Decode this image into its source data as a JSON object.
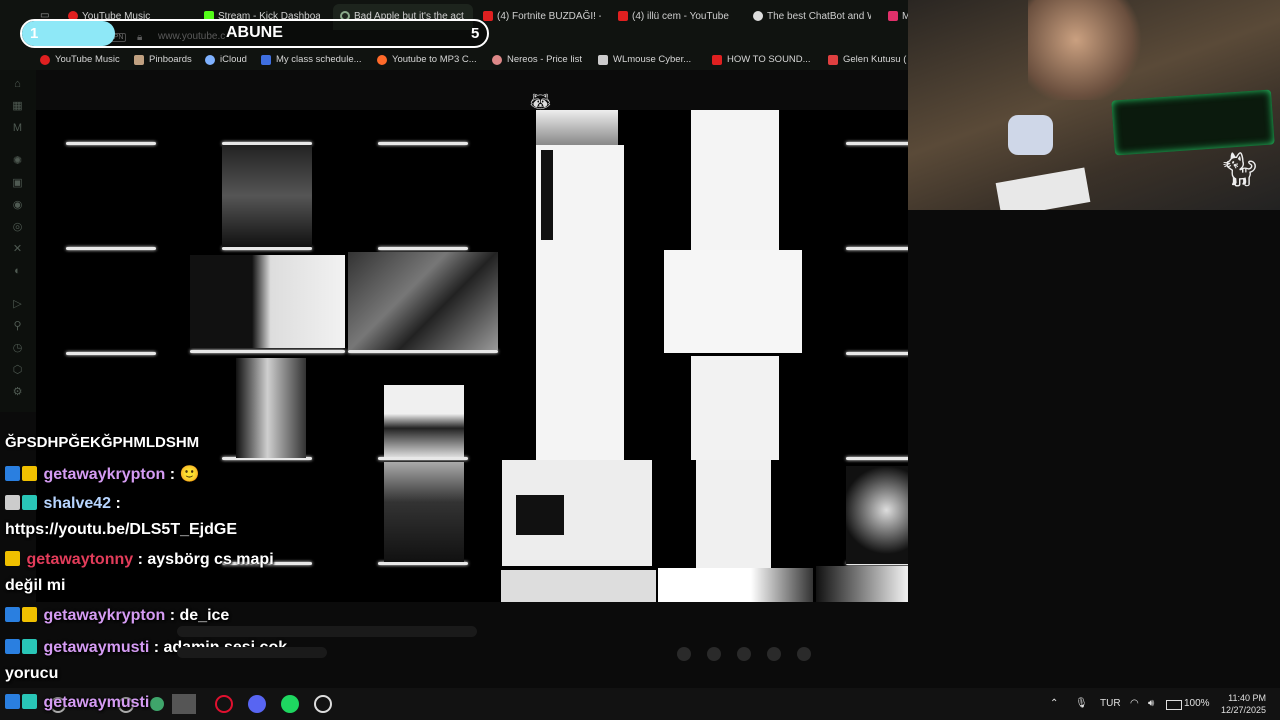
{
  "browser": {
    "tabs": [
      {
        "label": "YouTube Music",
        "color": "#e02020"
      },
      {
        "label": "Stream - Kick Dashboard",
        "color": "#53fc18"
      },
      {
        "label": "Bad Apple but it's the act",
        "color": "#8aa88a"
      },
      {
        "label": "(4) Fortnite BUZDAĞI! -",
        "color": "#e02020"
      },
      {
        "label": "(4) illü cem - YouTube",
        "color": "#e02020"
      },
      {
        "label": "The best ChatBot and W",
        "color": "#dddddd"
      },
      {
        "label": "M",
        "color": "#e0306a"
      }
    ],
    "url": "www.youtube.c",
    "vpn_label": "VPN",
    "bookmarks": [
      {
        "label": "YouTube Music",
        "color": "#e02020"
      },
      {
        "label": "Pinboards",
        "color": "#c0a080"
      },
      {
        "label": "iCloud",
        "color": "#7fb2ff"
      },
      {
        "label": "My class schedule...",
        "color": "#3f6fe0"
      },
      {
        "label": "Youtube to MP3 C...",
        "color": "#ff6a2a"
      },
      {
        "label": "Nereos - Price list",
        "color": "#d88"
      },
      {
        "label": "WLmouse Cyber...",
        "color": "#cccccc"
      },
      {
        "label": "HOW TO SOUND...",
        "color": "#e02020"
      },
      {
        "label": "Gelen Kutusu (",
        "color": "#e04040"
      }
    ]
  },
  "subscribe_goal": {
    "label": "ABUNE",
    "current": "1",
    "goal": "5",
    "progress": 0.2,
    "fill_color": "#8ee8f7"
  },
  "chat": {
    "header": "ĞPSDHPĞEKĞPHMLDSHM",
    "messages": [
      {
        "user": "getawaykrypton",
        "user_color": "#d49bf2",
        "text": ": 🙂",
        "badges": [
          "#2a7fe0",
          "#f0c000"
        ]
      },
      {
        "user": "shalve42",
        "user_color": "#b7d5ff",
        "text": ":",
        "text2": "https://youtu.be/DLS5T_EjdGE",
        "badges": [
          "#cccccc",
          "#29c6b7"
        ]
      },
      {
        "user": "getawaytonny",
        "user_color": "#e23c5a",
        "text": ": aysbörg cs mapi",
        "text2": "değil mi",
        "badges": [
          "#f0c000"
        ]
      },
      {
        "user": "getawaykrypton",
        "user_color": "#d49bf2",
        "text": ": de_ice",
        "badges": [
          "#2a7fe0",
          "#f0c000"
        ]
      },
      {
        "user": "getawaymusti",
        "user_color": "#d49bf2",
        "text": ": adamin sesi cok",
        "text2": "yorucu",
        "badges": [
          "#2a7fe0",
          "#29c6b7"
        ]
      },
      {
        "user": "getawaymusti",
        "user_color": "#d49bf2",
        "text": "",
        "badges": [
          "#2a7fe0",
          "#29c6b7"
        ]
      }
    ]
  },
  "taskbar": {
    "tray": {
      "language": "TUR",
      "battery": "100%"
    },
    "clock_time": "11:40 PM",
    "clock_date": "12/27/2025"
  },
  "icons": [
    "search-icon",
    "lock-icon",
    "discord-icon",
    "spotify-icon",
    "opera-icon",
    "wifi-icon",
    "volume-icon",
    "battery-icon",
    "mic-icon",
    "chevron-up-icon"
  ]
}
